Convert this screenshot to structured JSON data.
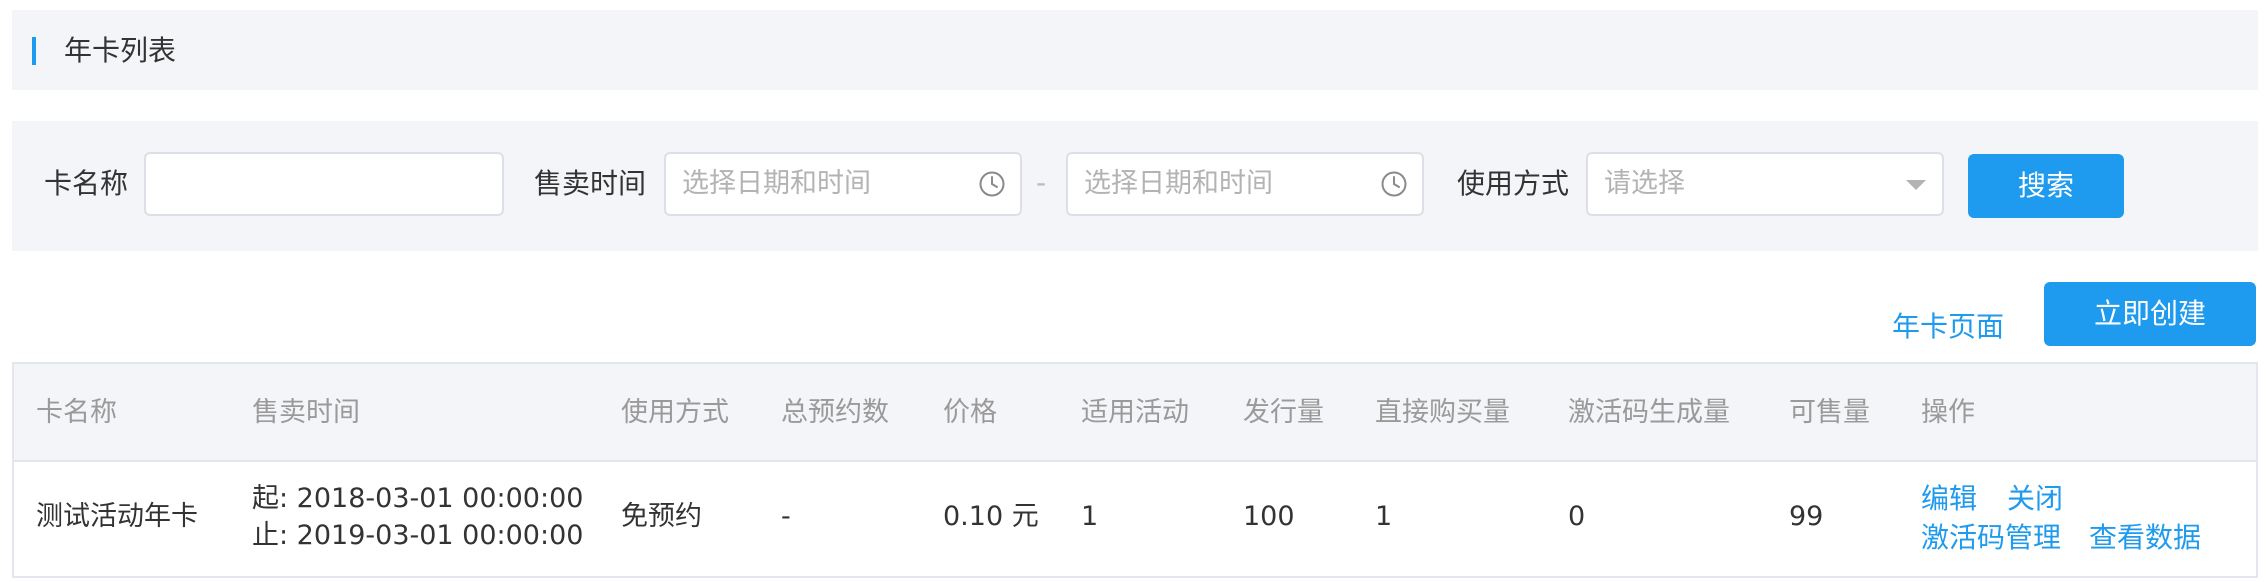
{
  "header": {
    "title": "年卡列表"
  },
  "filters": {
    "card_name_label": "卡名称",
    "card_name_value": "",
    "sale_time_label": "售卖时间",
    "start_placeholder": "选择日期和时间",
    "separator": "-",
    "end_placeholder": "选择日期和时间",
    "usage_label": "使用方式",
    "usage_placeholder": "请选择",
    "search_label": "搜索"
  },
  "actions": {
    "page_link": "年卡页面",
    "create_label": "立即创建"
  },
  "table": {
    "columns": [
      "卡名称",
      "售卖时间",
      "使用方式",
      "总预约数",
      "价格",
      "适用活动",
      "发行量",
      "直接购买量",
      "激活码生成量",
      "可售量",
      "操作"
    ],
    "rows": [
      {
        "name": "测试活动年卡",
        "sale_start": "起: 2018-03-01 00:00:00",
        "sale_end": "止: 2019-03-01 00:00:00",
        "usage": "免预约",
        "total_reservations": "-",
        "price": "0.10 元",
        "applicable_activities": "1",
        "issued": "100",
        "direct_purchases": "1",
        "codes_generated": "0",
        "available": "99",
        "ops": [
          "编辑",
          "关闭",
          "激活码管理",
          "查看数据"
        ]
      }
    ]
  },
  "colors": {
    "accent": "#1e9aee",
    "panel_bg": "#f4f5f8",
    "border": "#dcdfe6"
  }
}
